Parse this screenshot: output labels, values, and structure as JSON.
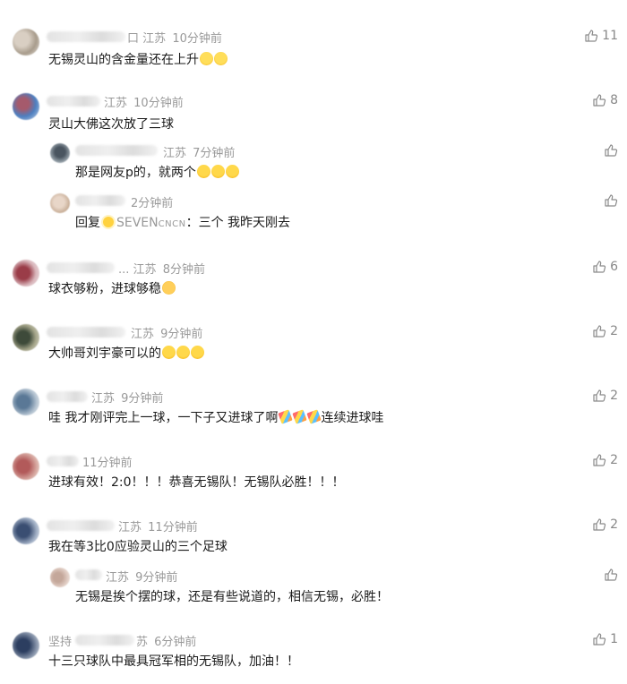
{
  "comments": [
    {
      "location": "江苏",
      "time": "10分钟前",
      "text": "无锡灵山的含金量还在上升",
      "likes": "11",
      "name_prefix": "口"
    },
    {
      "location": "江苏",
      "time": "10分钟前",
      "text": "灵山大佛这次放了三球",
      "likes": "8"
    },
    {
      "location": "江苏",
      "time": "7分钟前",
      "text": "那是网友p的，就两个",
      "likes": ""
    },
    {
      "location": "",
      "time": "2分钟前",
      "reply_prefix": "回复",
      "reply_to": "SEVEN",
      "reply_to_suffix": "CNCN",
      "text": "：三个 我昨天刚去",
      "likes": ""
    },
    {
      "location": "江苏",
      "time": "8分钟前",
      "text": "球衣够粉，进球够稳",
      "likes": "6",
      "name_prefix": "..."
    },
    {
      "location": "江苏",
      "time": "9分钟前",
      "text": "大帅哥刘宇豪可以的",
      "likes": "2"
    },
    {
      "location": "江苏",
      "time": "9分钟前",
      "text_a": "哇 我才刚评完上一球，一下子又进球了啊",
      "text_b": "连续进球哇",
      "likes": "2"
    },
    {
      "location": "",
      "time": "11分钟前",
      "text": "进球有效！2:0！！！恭喜无锡队！无锡队必胜！！！",
      "likes": "2"
    },
    {
      "location": "江苏",
      "time": "11分钟前",
      "text": "我在等3比0应验灵山的三个足球",
      "likes": "2"
    },
    {
      "location": "江苏",
      "time": "9分钟前",
      "text": "无锡是挨个摆的球，还是有些说道的，相信无锡，必胜！",
      "likes": ""
    },
    {
      "location": "",
      "time": "6分钟前",
      "name_prefix": "坚持",
      "loc_partial": "苏",
      "text": "十三只球队中最具冠军相的无锡队，加油！！",
      "likes": "1"
    }
  ],
  "icons": {
    "like": "thumbs-up-icon"
  },
  "colors": {
    "meta": "#999999",
    "text": "#1a1a1a",
    "like": "#888888"
  }
}
